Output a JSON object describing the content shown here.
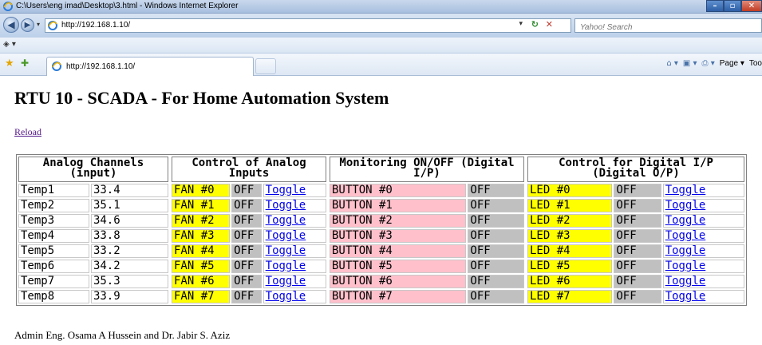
{
  "window": {
    "title": "C:\\Users\\eng imad\\Desktop\\3.html - Windows Internet Explorer",
    "controls": [
      "–",
      "▫",
      "✕"
    ]
  },
  "address_bar": {
    "url": "http://192.168.1.10/",
    "search_placeholder": "Yahoo! Search"
  },
  "tab": {
    "label": "http://192.168.1.10/"
  },
  "command_bar": {
    "page_label": "Page ▾",
    "tools_label": "Too"
  },
  "page": {
    "title": "RTU 10 - SCADA - For Home Automation System",
    "reload_label": "Reload",
    "footer": "Admin Eng. Osama A Hussein and Dr. Jabir S. Aziz"
  },
  "headers": {
    "analog": "Analog Channels (input)",
    "control_analog": "Control of Analog Inputs",
    "monitoring": "Monitoring ON/OFF (Digital I/P)",
    "control_digital": "Control for Digital I/P (Digital O/P)"
  },
  "analog": [
    {
      "name": "Temp1",
      "value": "33.4"
    },
    {
      "name": "Temp2",
      "value": "35.1"
    },
    {
      "name": "Temp3",
      "value": "34.6"
    },
    {
      "name": "Temp4",
      "value": "33.8"
    },
    {
      "name": "Temp5",
      "value": "33.2"
    },
    {
      "name": "Temp6",
      "value": "34.2"
    },
    {
      "name": "Temp7",
      "value": "35.3"
    },
    {
      "name": "Temp8",
      "value": "33.9"
    }
  ],
  "fans": [
    {
      "name": "FAN #0",
      "state": "OFF",
      "action": "Toggle"
    },
    {
      "name": "FAN #1",
      "state": "OFF",
      "action": "Toggle"
    },
    {
      "name": "FAN #2",
      "state": "OFF",
      "action": "Toggle"
    },
    {
      "name": "FAN #3",
      "state": "OFF",
      "action": "Toggle"
    },
    {
      "name": "FAN #4",
      "state": "OFF",
      "action": "Toggle"
    },
    {
      "name": "FAN #5",
      "state": "OFF",
      "action": "Toggle"
    },
    {
      "name": "FAN #6",
      "state": "OFF",
      "action": "Toggle"
    },
    {
      "name": "FAN #7",
      "state": "OFF",
      "action": "Toggle"
    }
  ],
  "buttons": [
    {
      "name": "BUTTON #0",
      "state": "OFF"
    },
    {
      "name": "BUTTON #1",
      "state": "OFF"
    },
    {
      "name": "BUTTON #2",
      "state": "OFF"
    },
    {
      "name": "BUTTON #3",
      "state": "OFF"
    },
    {
      "name": "BUTTON #4",
      "state": "OFF"
    },
    {
      "name": "BUTTON #5",
      "state": "OFF"
    },
    {
      "name": "BUTTON #6",
      "state": "OFF"
    },
    {
      "name": "BUTTON #7",
      "state": "OFF"
    }
  ],
  "leds": [
    {
      "name": "LED #0",
      "state": "OFF",
      "action": "Toggle"
    },
    {
      "name": "LED #1",
      "state": "OFF",
      "action": "Toggle"
    },
    {
      "name": "LED #2",
      "state": "OFF",
      "action": "Toggle"
    },
    {
      "name": "LED #3",
      "state": "OFF",
      "action": "Toggle"
    },
    {
      "name": "LED #4",
      "state": "OFF",
      "action": "Toggle"
    },
    {
      "name": "LED #5",
      "state": "OFF",
      "action": "Toggle"
    },
    {
      "name": "LED #6",
      "state": "OFF",
      "action": "Toggle"
    },
    {
      "name": "LED #7",
      "state": "OFF",
      "action": "Toggle"
    }
  ],
  "colors": {
    "yellow_cell": "#ffff00",
    "pink_cell": "#ffc0cb",
    "grey_cell": "#c0c0c0",
    "link": "#0000ee",
    "visited_link": "#551a8b"
  },
  "icons": {
    "browser": "ie-logo-icon",
    "back": "back-arrow-icon",
    "forward": "forward-arrow-icon",
    "refresh": "refresh-icon",
    "stop": "stop-icon",
    "favorites": "star-icon",
    "add_favorites": "add-favorites-icon",
    "home": "home-icon",
    "feeds": "feeds-icon",
    "print": "print-icon"
  }
}
